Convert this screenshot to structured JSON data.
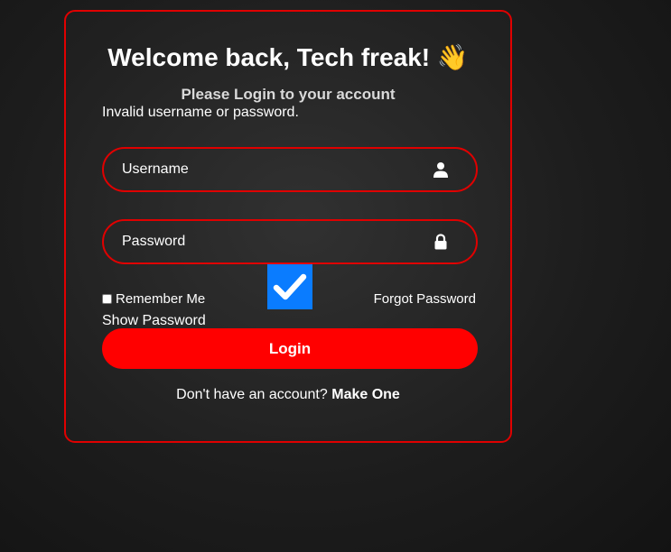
{
  "colors": {
    "accent": "#e00000",
    "button": "#ff0000",
    "checkbox_checked": "#0a7cff",
    "text": "#ffffff",
    "subtitle": "#d9d9d9"
  },
  "header": {
    "title": "Welcome back, Tech freak! 👋",
    "subtitle": "Please Login to your account"
  },
  "error_message": "Invalid username or password.",
  "form": {
    "username": {
      "placeholder": "Username",
      "value": "",
      "icon": "user-icon"
    },
    "password": {
      "placeholder": "Password",
      "value": "",
      "icon": "lock-icon"
    },
    "remember_label": "Remember Me",
    "remember_checked": false,
    "show_password_label": "Show Password",
    "show_password_checked": true,
    "forgot_label": "Forgot Password",
    "login_label": "Login"
  },
  "footer": {
    "prompt": "Don't have an account?",
    "link": "Make One"
  }
}
